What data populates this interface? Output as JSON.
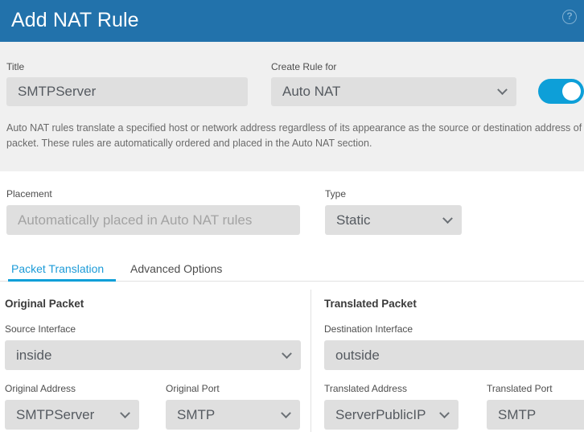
{
  "header": {
    "title": "Add NAT Rule",
    "help_icon": "help-circle-icon",
    "help_glyph": "?",
    "background_color": "#2272ab"
  },
  "form": {
    "title_field": {
      "label": "Title",
      "value": "SMTPServer"
    },
    "create_rule_for": {
      "label": "Create Rule for",
      "value": "Auto NAT",
      "chevron_icon": "chevron-down-icon"
    },
    "enable_toggle": {
      "state": "on",
      "color": "#0d9fd8"
    },
    "description": "Auto NAT rules translate a specified host or network address regardless of its appearance as the source or destination address of a packet. These rules are automatically ordered and placed in the Auto NAT section.",
    "placement": {
      "label": "Placement",
      "value": "Automatically placed in Auto NAT rules",
      "disabled": true
    },
    "type": {
      "label": "Type",
      "value": "Static",
      "chevron_icon": "chevron-down-icon"
    }
  },
  "tabs": [
    {
      "label": "Packet Translation",
      "active": true
    },
    {
      "label": "Advanced Options",
      "active": false
    }
  ],
  "original_packet": {
    "heading": "Original Packet",
    "source_interface": {
      "label": "Source Interface",
      "value": "inside"
    },
    "original_address": {
      "label": "Original Address",
      "value": "SMTPServer"
    },
    "original_port": {
      "label": "Original Port",
      "value": "SMTP"
    }
  },
  "translated_packet": {
    "heading": "Translated Packet",
    "destination_interface": {
      "label": "Destination Interface",
      "value": "outside"
    },
    "translated_address": {
      "label": "Translated Address",
      "value": "ServerPublicIP"
    },
    "translated_port": {
      "label": "Translated Port",
      "value": "SMTP"
    }
  },
  "colors": {
    "header_blue": "#2272ab",
    "accent_blue": "#0d9fd8",
    "tab_active": "#1c9bd8",
    "field_grey": "#dfdfdf",
    "section_grey": "#f0f0f0"
  }
}
